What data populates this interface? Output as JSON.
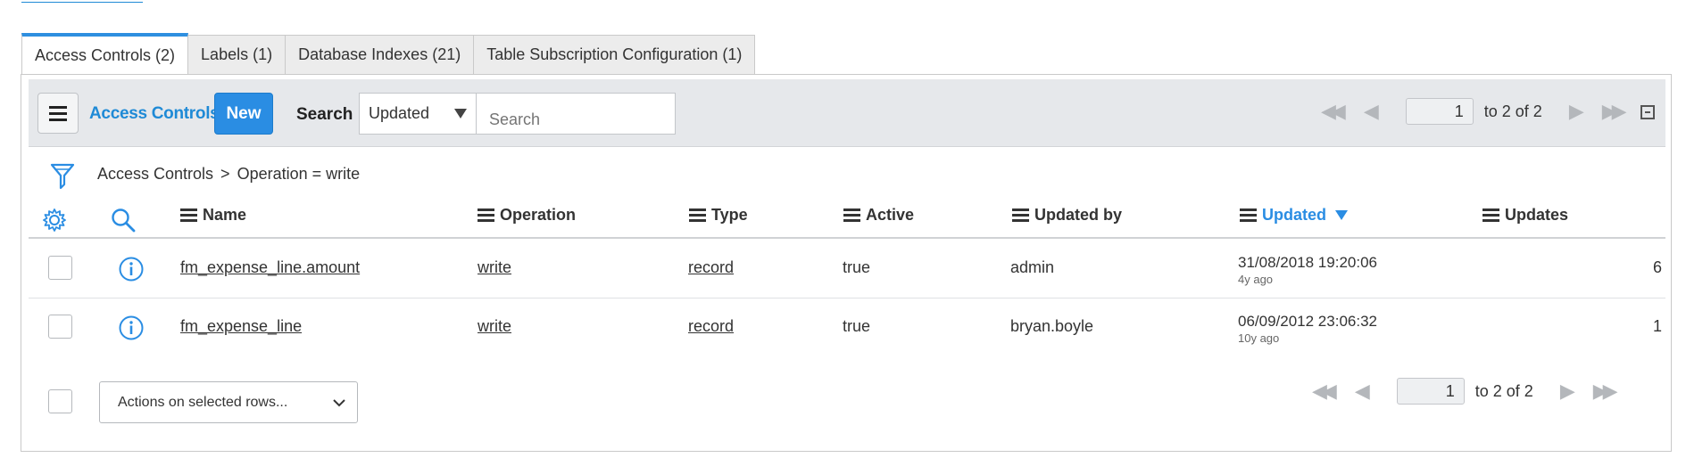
{
  "tabs": [
    {
      "label": "Access Controls (2)",
      "active": true
    },
    {
      "label": "Labels (1)",
      "active": false
    },
    {
      "label": "Database Indexes (21)",
      "active": false
    },
    {
      "label": "Table Subscription Configuration (1)",
      "active": false
    }
  ],
  "toolbar": {
    "list_title": "Access Controls",
    "new_label": "New",
    "search_label": "Search",
    "search_field_selected": "Updated",
    "search_placeholder": "Search",
    "page_value": "1",
    "range_text": "to 2 of 2"
  },
  "breadcrumb": {
    "root": "Access Controls",
    "separator": ">",
    "condition": "Operation = write"
  },
  "columns": {
    "name": "Name",
    "operation": "Operation",
    "type": "Type",
    "active": "Active",
    "updated_by": "Updated by",
    "updated": "Updated",
    "updates": "Updates"
  },
  "rows": [
    {
      "name": "fm_expense_line.amount",
      "operation": "write",
      "type": "record",
      "active": "true",
      "updated_by": "admin",
      "updated": "31/08/2018 19:20:06",
      "updated_ago": "4y ago",
      "updates": "6"
    },
    {
      "name": "fm_expense_line",
      "operation": "write",
      "type": "record",
      "active": "true",
      "updated_by": "bryan.boyle",
      "updated": "06/09/2012 23:06:32",
      "updated_ago": "10y ago",
      "updates": "1"
    }
  ],
  "footer": {
    "actions_label": "Actions on selected rows...",
    "page_value": "1",
    "range_text": "to 2 of 2"
  },
  "colors": {
    "accent": "#2a8de3",
    "toolbar_bg": "#e6e8eb"
  },
  "icons": [
    "hamburger-menu-icon",
    "filter-icon",
    "gear-icon",
    "search-icon",
    "info-icon",
    "first-page-icon",
    "prev-page-icon",
    "next-page-icon",
    "last-page-icon",
    "collapse-icon",
    "chevron-down-icon"
  ]
}
